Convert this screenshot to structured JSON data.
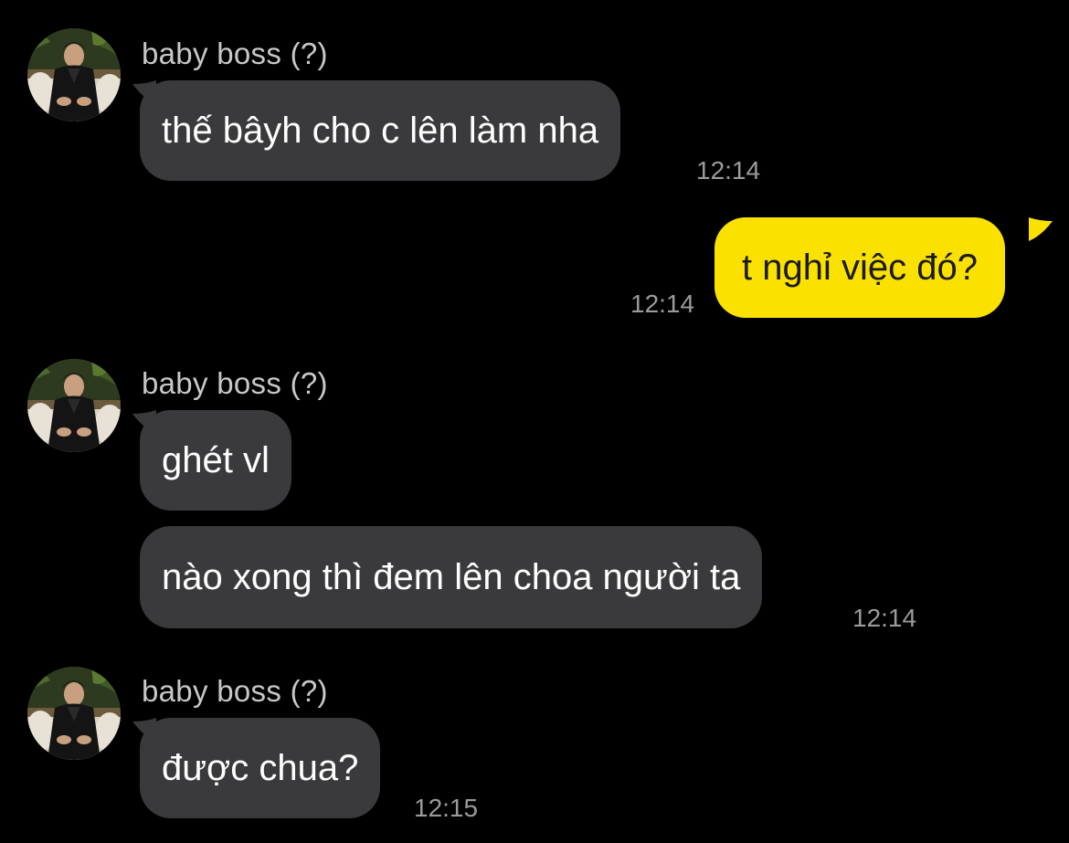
{
  "chat": {
    "messages": [
      {
        "sender": "baby boss (?)",
        "text": "thế bâyh cho c lên làm nha",
        "time": "12:14"
      },
      {
        "text": "t nghỉ việc đó?",
        "time": "12:14"
      },
      {
        "sender": "baby boss (?)",
        "text": "ghét vl"
      },
      {
        "text": "nào xong thì đem lên choa người ta",
        "time": "12:14"
      },
      {
        "sender": "baby boss (?)",
        "text": "được chua?",
        "time": "12:15"
      }
    ]
  },
  "colors": {
    "background": "#000000",
    "incoming_bubble": "#3a3a3c",
    "outgoing_bubble": "#fae100",
    "timestamp": "#9b9b9b",
    "sender_name": "#c8c8c8"
  },
  "icons": [
    "profile-avatar"
  ]
}
